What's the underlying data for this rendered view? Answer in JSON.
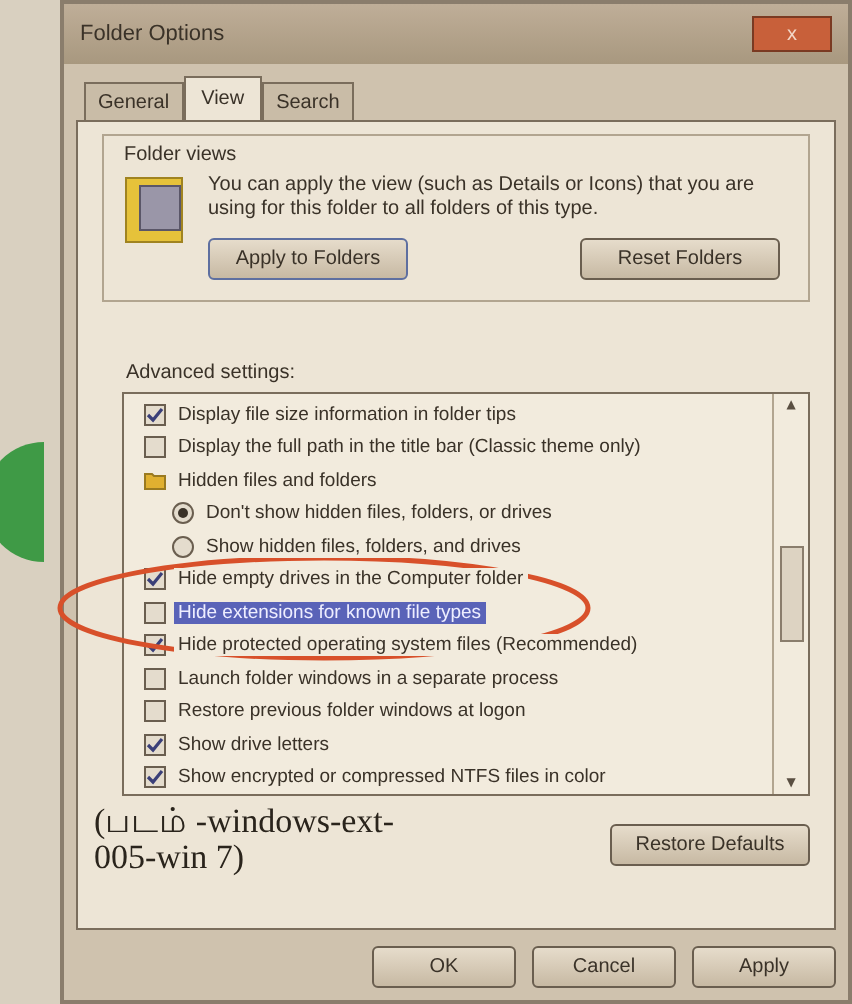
{
  "window": {
    "title": "Folder Options",
    "close": "x"
  },
  "tabs": [
    {
      "label": "General",
      "selected": false
    },
    {
      "label": "View",
      "selected": true
    },
    {
      "label": "Search",
      "selected": false
    }
  ],
  "folder_views": {
    "title": "Folder views",
    "text": "You can apply the view (such as Details or Icons) that you are using for this folder to all folders of this type.",
    "buttons": [
      {
        "label": "Apply to Folders",
        "focused": true
      },
      {
        "label": "Reset Folders",
        "focused": false
      }
    ]
  },
  "advanced": {
    "title": "Advanced settings:",
    "items": [
      {
        "kind": "checkbox",
        "label": "Display file size information in folder tips",
        "checked": true,
        "selected": false
      },
      {
        "kind": "checkbox",
        "label": "Display the full path in the title bar (Classic theme only)",
        "checked": false,
        "selected": false
      },
      {
        "kind": "group",
        "label": "Hidden files and folders",
        "selected": false
      },
      {
        "kind": "radio",
        "label": "Don't show hidden files, folders, or drives",
        "checked": true,
        "selected": false
      },
      {
        "kind": "radio",
        "label": "Show hidden files, folders, and drives",
        "checked": false,
        "selected": false
      },
      {
        "kind": "checkbox",
        "label": "Hide empty drives in the Computer folder",
        "checked": true,
        "selected": false
      },
      {
        "kind": "checkbox",
        "label": "Hide extensions for known file types",
        "checked": false,
        "selected": true
      },
      {
        "kind": "checkbox",
        "label": "Hide protected operating system files (Recommended)",
        "checked": true,
        "selected": false
      },
      {
        "kind": "checkbox",
        "label": "Launch folder windows in a separate process",
        "checked": false,
        "selected": false
      },
      {
        "kind": "checkbox",
        "label": "Restore previous folder windows at logon",
        "checked": false,
        "selected": false
      },
      {
        "kind": "checkbox",
        "label": "Show drive letters",
        "checked": true,
        "selected": false
      },
      {
        "kind": "checkbox",
        "label": "Show encrypted or compressed NTFS files in color",
        "checked": true,
        "selected": false
      }
    ],
    "scroll_up": "▲",
    "scroll_down": "▼"
  },
  "caption": "(படம் -windows-ext-005-win 7)",
  "restore_button": "Restore Defaults",
  "dialog_buttons": [
    "OK",
    "Cancel",
    "Apply"
  ]
}
